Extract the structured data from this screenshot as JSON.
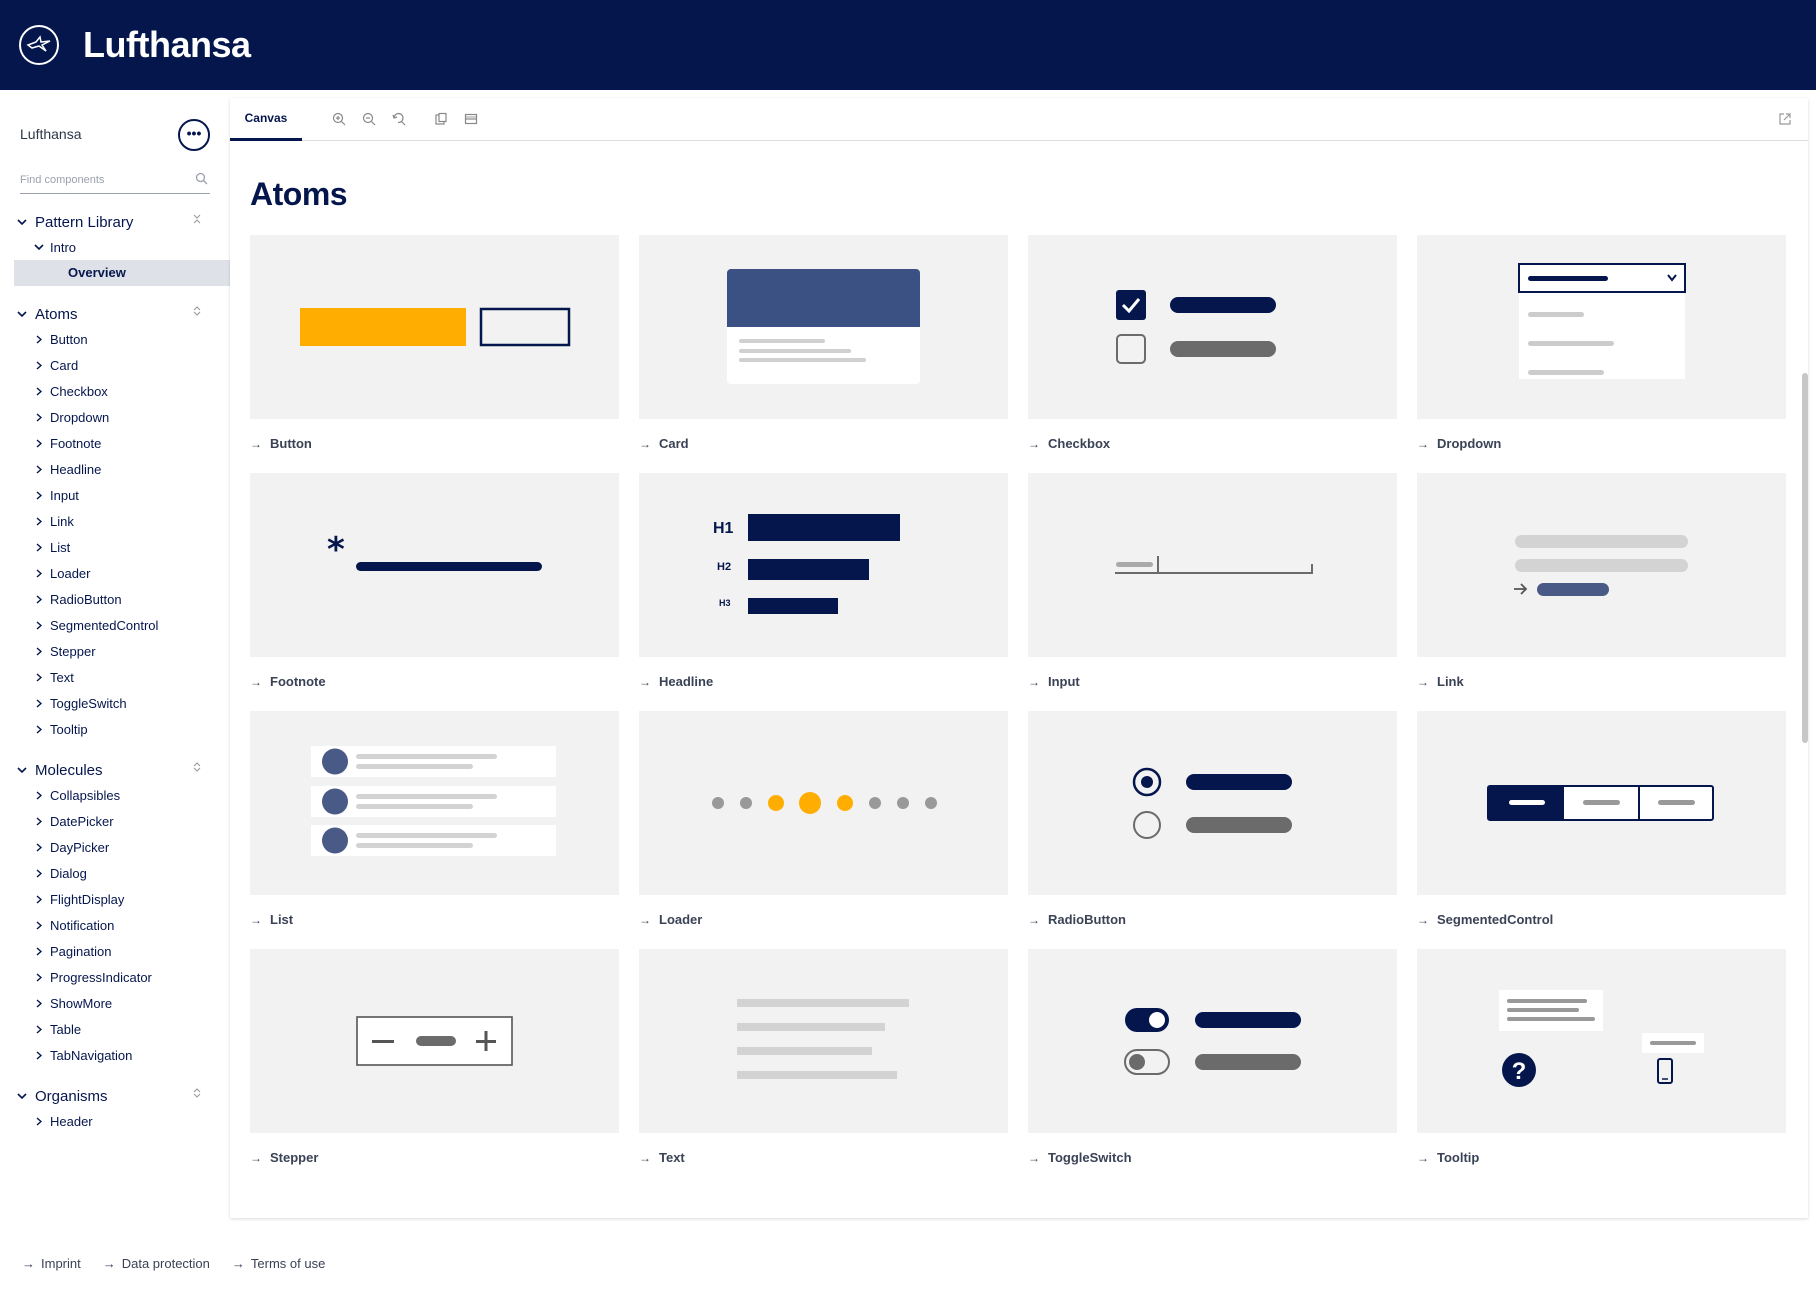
{
  "brand": {
    "name": "Lufthansa",
    "logo_icon": "crane-logo-icon",
    "color": "#05164d"
  },
  "sidebar": {
    "title": "Lufthansa",
    "more_label": "•••",
    "search_placeholder": "Find components",
    "sections": [
      {
        "label": "Pattern Library"
      },
      {
        "label": "Atoms"
      },
      {
        "label": "Molecules"
      },
      {
        "label": "Organisms"
      }
    ],
    "intro_label": "Intro",
    "overview_label": "Overview",
    "atoms": [
      "Button",
      "Card",
      "Checkbox",
      "Dropdown",
      "Footnote",
      "Headline",
      "Input",
      "Link",
      "List",
      "Loader",
      "RadioButton",
      "SegmentedControl",
      "Stepper",
      "Text",
      "ToggleSwitch",
      "Tooltip"
    ],
    "molecules": [
      "Collapsibles",
      "DatePicker",
      "DayPicker",
      "Dialog",
      "FlightDisplay",
      "Notification",
      "Pagination",
      "ProgressIndicator",
      "ShowMore",
      "Table",
      "TabNavigation"
    ],
    "organisms": [
      "Header"
    ]
  },
  "toolbar": {
    "canvas_tab": "Canvas"
  },
  "main": {
    "title": "Atoms",
    "cards": [
      "Button",
      "Card",
      "Checkbox",
      "Dropdown",
      "Footnote",
      "Headline",
      "Input",
      "Link",
      "List",
      "Loader",
      "RadioButton",
      "SegmentedControl",
      "Stepper",
      "Text",
      "ToggleSwitch",
      "Tooltip"
    ],
    "headline_labels": [
      "H1",
      "H2",
      "H3"
    ],
    "footnote_mark": "*",
    "tooltip_mark": "?"
  },
  "footer": {
    "links": [
      "Imprint",
      "Data protection",
      "Terms of use"
    ]
  },
  "colors": {
    "navy": "#05164d",
    "yellow": "#ffad00",
    "slate": "#4a5a86",
    "gray": "#6b6b6b",
    "light": "#f2f2f2"
  }
}
